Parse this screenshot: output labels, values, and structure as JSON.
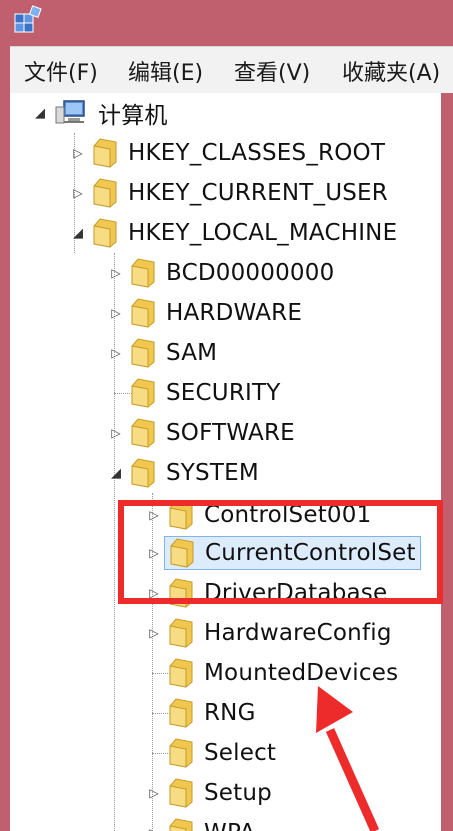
{
  "menu": {
    "file": "文件(F)",
    "edit": "编辑(E)",
    "view": "查看(V)",
    "favorites": "收藏夹(A)"
  },
  "tree": {
    "root": "计算机",
    "hives": [
      "HKEY_CLASSES_ROOT",
      "HKEY_CURRENT_USER",
      "HKEY_LOCAL_MACHINE"
    ],
    "hklm_children": [
      "BCD00000000",
      "HARDWARE",
      "SAM",
      "SECURITY",
      "SOFTWARE",
      "SYSTEM"
    ],
    "system_children": [
      "ControlSet001",
      "CurrentControlSet",
      "DriverDatabase",
      "HardwareConfig",
      "MountedDevices",
      "RNG",
      "Select",
      "Setup",
      "WPA"
    ],
    "selected": "CurrentControlSet"
  },
  "colors": {
    "window_frame": "#c0606f",
    "highlight_box": "#ee2b2b",
    "selection": "#dcecfc",
    "folder": "#f0c850"
  },
  "icons": {
    "app": "regedit-icon",
    "computer": "computer-icon",
    "folder": "folder-icon",
    "collapsed": "triangle-right",
    "expanded": "triangle-down"
  }
}
